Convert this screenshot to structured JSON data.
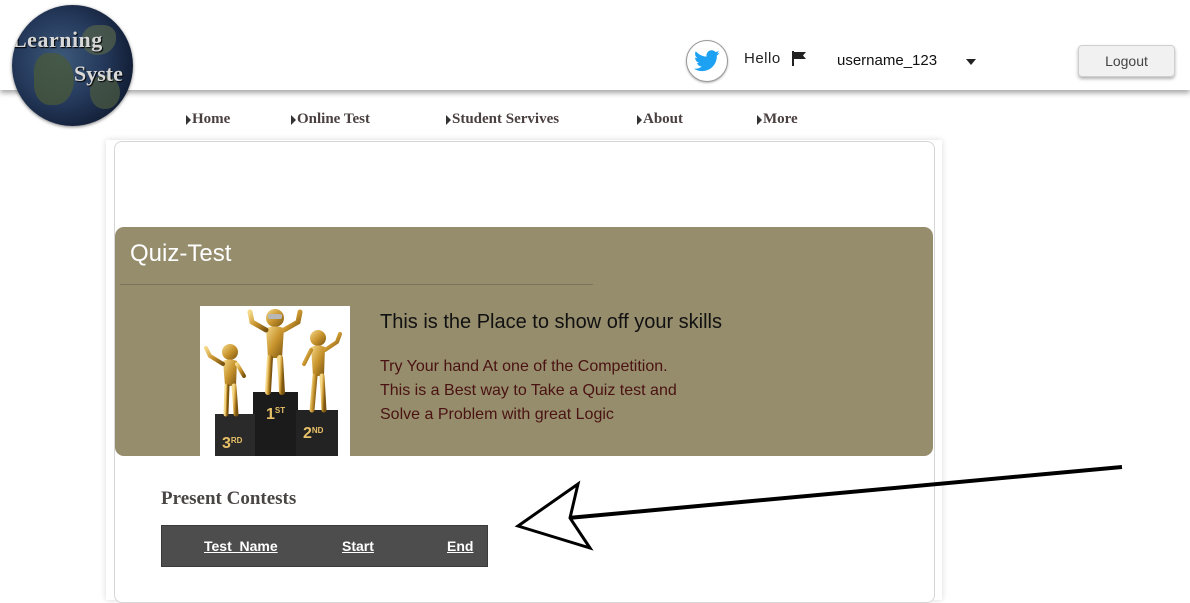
{
  "header": {
    "logo_text_line1": "Learning",
    "logo_text_line2": "Syste",
    "hello": "Hello",
    "username": "username_123",
    "logout_label": "Logout"
  },
  "nav": [
    {
      "label": "Home"
    },
    {
      "label": "Online Test"
    },
    {
      "label": "Student Servives"
    },
    {
      "label": "About"
    },
    {
      "label": "More"
    }
  ],
  "banner": {
    "title": "Quiz-Test",
    "headline": "This is the Place to show off your skills",
    "lines": [
      "Try Your hand At one of the Competition.",
      "This is a Best way to Take a Quiz test and",
      "Solve a Problem with great Logic"
    ],
    "podium_labels": [
      "1ST",
      "2ND",
      "3RD"
    ]
  },
  "contests": {
    "title": "Present Contests",
    "columns": [
      "Test_Name",
      "Start",
      "End"
    ]
  },
  "colors": {
    "banner": "#958d6c",
    "table_header": "#4d4d4d",
    "desc_text": "#4a1212"
  }
}
